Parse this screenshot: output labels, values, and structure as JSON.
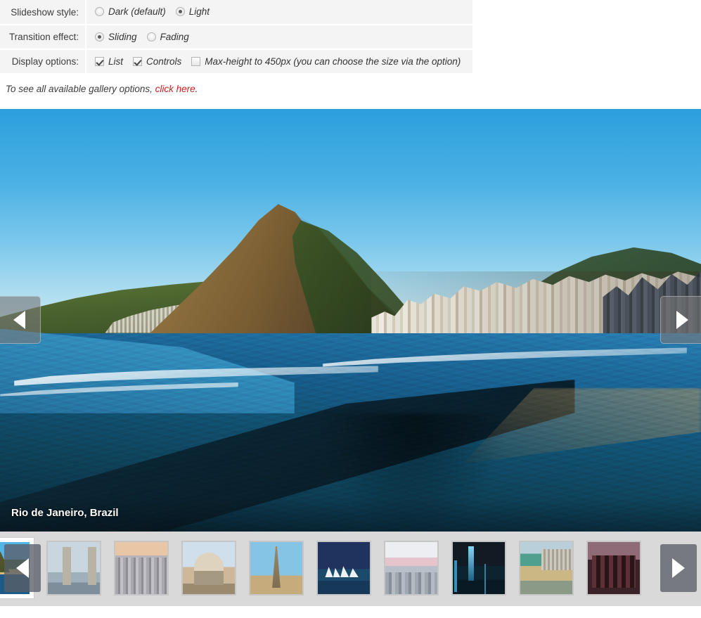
{
  "options": {
    "rows": [
      {
        "label": "Slideshow style:",
        "type": "radio",
        "items": [
          {
            "text": "Dark (default)",
            "checked": false,
            "name": "radio-dark"
          },
          {
            "text": "Light",
            "checked": true,
            "name": "radio-light"
          }
        ]
      },
      {
        "label": "Transition effect:",
        "type": "radio",
        "items": [
          {
            "text": "Sliding",
            "checked": true,
            "name": "radio-sliding"
          },
          {
            "text": "Fading",
            "checked": false,
            "name": "radio-fading"
          }
        ]
      },
      {
        "label": "Display options:",
        "type": "checkbox",
        "items": [
          {
            "text": "List",
            "checked": true,
            "name": "checkbox-list"
          },
          {
            "text": "Controls",
            "checked": true,
            "name": "checkbox-controls"
          },
          {
            "text": "Max-height to 450px (you can choose the size via the option)",
            "checked": false,
            "name": "checkbox-max-height"
          }
        ]
      }
    ]
  },
  "hint": {
    "before": "To see all available gallery options, ",
    "link": "click here",
    "after": "."
  },
  "gallery": {
    "caption": "Rio de Janeiro, Brazil",
    "prev_arrow": "◀",
    "next_arrow": "▶",
    "thumb_prev_arrow": "◀",
    "thumb_next_arrow": "▶",
    "accent_link_color": "#cc2222",
    "strip_background": "#d9d9d9",
    "thumbs": [
      {
        "name": "thumb-rio",
        "style": "t-rio",
        "active": true,
        "partial": false
      },
      {
        "name": "thumb-london",
        "style": "t-london",
        "active": false,
        "partial": false
      },
      {
        "name": "thumb-new-york",
        "style": "t-ny",
        "active": false,
        "partial": false
      },
      {
        "name": "thumb-delhi",
        "style": "t-delhi",
        "active": false,
        "partial": false
      },
      {
        "name": "thumb-paris",
        "style": "t-paris",
        "active": false,
        "partial": false
      },
      {
        "name": "thumb-sydney",
        "style": "t-sydney",
        "active": false,
        "partial": false
      },
      {
        "name": "thumb-dawn-city",
        "style": "t-dawn",
        "active": false,
        "partial": false
      },
      {
        "name": "thumb-night-skyline",
        "style": "t-night",
        "active": false,
        "partial": false
      },
      {
        "name": "thumb-coast",
        "style": "t-beach",
        "active": false,
        "partial": false
      },
      {
        "name": "thumb-red-night",
        "style": "t-red",
        "active": false,
        "partial": true
      }
    ]
  }
}
